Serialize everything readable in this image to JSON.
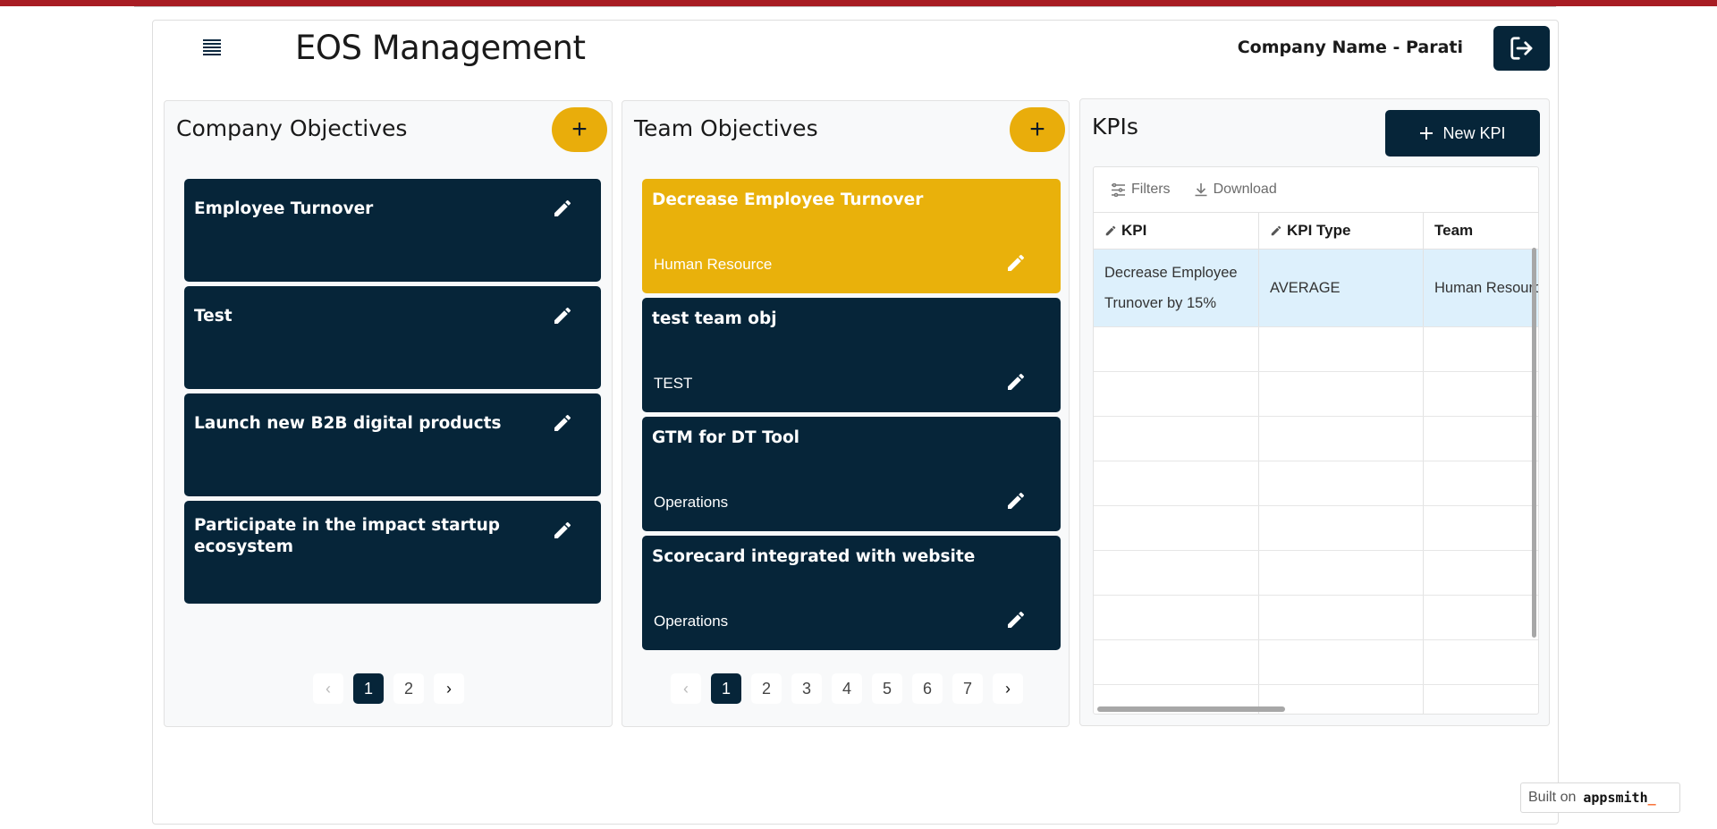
{
  "header": {
    "title": "EOS Management",
    "company": "Company Name - Parati"
  },
  "company_objectives": {
    "title": "Company Objectives",
    "add_label": "+",
    "cards": [
      {
        "title": "Employee Turnover"
      },
      {
        "title": "Test"
      },
      {
        "title": "Launch new B2B digital products"
      },
      {
        "title": "Participate in the impact startup ecosystem"
      }
    ],
    "pagination": {
      "prev": "‹",
      "pages": [
        "1",
        "2"
      ],
      "next": "›",
      "current": "1"
    }
  },
  "team_objectives": {
    "title": "Team Objectives",
    "add_label": "+",
    "cards": [
      {
        "title": "Decrease Employee Turnover",
        "team": "Human Resource"
      },
      {
        "title": "test team obj",
        "team": "TEST"
      },
      {
        "title": "GTM for DT Tool",
        "team": "Operations"
      },
      {
        "title": "Scorecard integrated with website",
        "team": "Operations"
      }
    ],
    "pagination": {
      "prev": "‹",
      "pages": [
        "1",
        "2",
        "3",
        "4",
        "5",
        "6",
        "7"
      ],
      "next": "›",
      "current": "1"
    }
  },
  "kpis": {
    "title": "KPIs",
    "new_label": "New KPI",
    "toolbar": {
      "filters": "Filters",
      "download": "Download"
    },
    "columns": [
      "KPI",
      "KPI Type",
      "Team"
    ],
    "rows": [
      {
        "kpi": "Decrease Employee Trunover by 15%",
        "type": "AVERAGE",
        "team": "Human Resource"
      }
    ]
  },
  "footer": {
    "built_on": "Built on",
    "brand": "appsmith",
    "brand_accent": "_"
  },
  "colors": {
    "navy": "#062539",
    "amber": "#e9ad0b",
    "topbar": "#a81d24",
    "selected_row": "#ddf0fc"
  }
}
